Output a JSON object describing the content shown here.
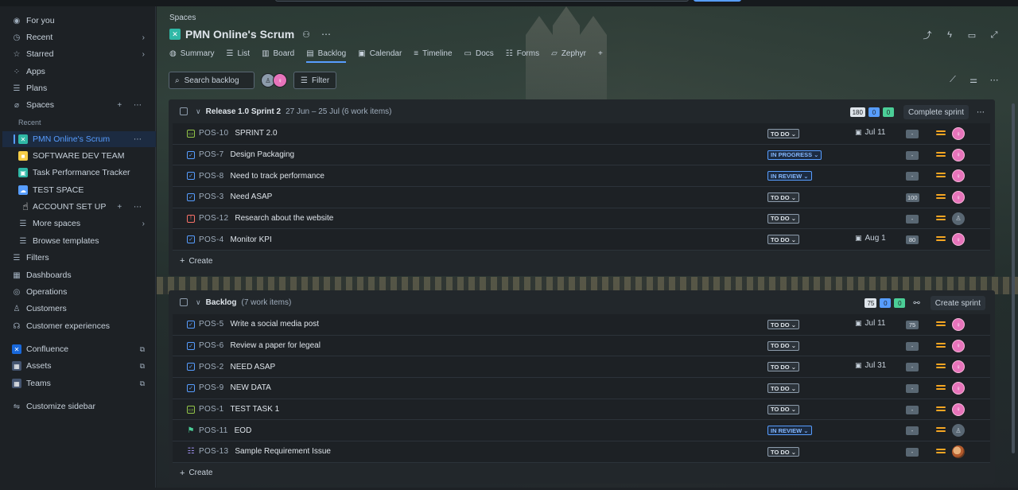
{
  "sidebar": {
    "items": [
      {
        "label": "For you",
        "icon": "user-circle-icon"
      },
      {
        "label": "Recent",
        "icon": "clock-icon"
      },
      {
        "label": "Starred",
        "icon": "star-icon"
      },
      {
        "label": "Apps",
        "icon": "apps-icon"
      },
      {
        "label": "Plans",
        "icon": "plans-icon"
      },
      {
        "label": "Spaces",
        "icon": "spaces-icon"
      }
    ],
    "recent_label": "Recent",
    "spaces": [
      {
        "label": "PMN Online's Scrum",
        "color": "#2fb8a6"
      },
      {
        "label": "SOFTWARE DEV TEAM",
        "color": "#f5cd47"
      },
      {
        "label": "Task Performance Tracker",
        "color": "#2fb8a6"
      },
      {
        "label": "TEST SPACE",
        "color": "#579dff"
      },
      {
        "label": "ACCOUNT SET UP",
        "color": "#9f8fef"
      }
    ],
    "more_spaces": "More spaces",
    "browse_templates": "Browse templates",
    "bottom_items": [
      {
        "label": "Filters"
      },
      {
        "label": "Dashboards"
      },
      {
        "label": "Operations"
      },
      {
        "label": "Customers"
      },
      {
        "label": "Customer experiences"
      }
    ],
    "apps": [
      {
        "label": "Confluence",
        "color": "#1868db"
      },
      {
        "label": "Assets",
        "color": "#44546f"
      },
      {
        "label": "Teams",
        "color": "#44546f"
      }
    ],
    "customize": "Customize sidebar"
  },
  "header": {
    "breadcrumb": "Spaces",
    "title": "PMN Online's Scrum",
    "tabs": [
      "Summary",
      "List",
      "Board",
      "Backlog",
      "Calendar",
      "Timeline",
      "Docs",
      "Forms",
      "Zephyr"
    ],
    "active_tab": "Backlog"
  },
  "toolbar": {
    "search_placeholder": "Search backlog",
    "filter_label": "Filter"
  },
  "sprint": {
    "title": "Release 1.0 Sprint 2",
    "meta": "27 Jun – 25 Jul (6 work items)",
    "counts": [
      "180",
      "0",
      "0"
    ],
    "action": "Complete sprint",
    "rows": [
      {
        "type": "story",
        "key": "POS-10",
        "summary": "SPRINT 2.0",
        "status": "TO DO",
        "due": "Jul 11",
        "est": "-",
        "assignee": "pink"
      },
      {
        "type": "task",
        "key": "POS-7",
        "summary": "Design Packaging",
        "status": "IN PROGRESS",
        "due": "",
        "est": "-",
        "assignee": "pink"
      },
      {
        "type": "task",
        "key": "POS-8",
        "summary": "Need to track performance",
        "status": "IN REVIEW",
        "due": "",
        "est": "-",
        "assignee": "pink"
      },
      {
        "type": "task",
        "key": "POS-3",
        "summary": "Need ASAP",
        "status": "TO DO",
        "due": "",
        "est": "100",
        "assignee": "pink"
      },
      {
        "type": "bug",
        "key": "POS-12",
        "summary": "Research about the website",
        "status": "TO DO",
        "due": "",
        "est": "-",
        "assignee": "grey"
      },
      {
        "type": "task",
        "key": "POS-4",
        "summary": "Monitor KPI",
        "status": "TO DO",
        "due": "Aug 1",
        "est": "80",
        "assignee": "pink"
      }
    ],
    "create": "Create"
  },
  "backlog": {
    "title": "Backlog",
    "meta": "(7 work items)",
    "counts": [
      "75",
      "0",
      "0"
    ],
    "action": "Create sprint",
    "rows": [
      {
        "type": "task",
        "key": "POS-5",
        "summary": "Write a social media post",
        "status": "TO DO",
        "due": "Jul 11",
        "est": "75",
        "assignee": "pink"
      },
      {
        "type": "task",
        "key": "POS-6",
        "summary": "Review a paper for legeal",
        "status": "TO DO",
        "due": "",
        "est": "-",
        "assignee": "pink"
      },
      {
        "type": "task",
        "key": "POS-2",
        "summary": "NEED ASAP",
        "status": "TO DO",
        "due": "Jul 31",
        "est": "-",
        "assignee": "pink"
      },
      {
        "type": "task",
        "key": "POS-9",
        "summary": "NEW DATA",
        "status": "TO DO",
        "due": "",
        "est": "-",
        "assignee": "pink"
      },
      {
        "type": "story",
        "key": "POS-1",
        "summary": "TEST TASK 1",
        "status": "TO DO",
        "due": "",
        "est": "-",
        "assignee": "pink"
      },
      {
        "type": "mark",
        "key": "POS-11",
        "summary": "EOD",
        "status": "IN REVIEW",
        "due": "",
        "est": "-",
        "assignee": "grey"
      },
      {
        "type": "req",
        "key": "POS-13",
        "summary": "Sample Requirement Issue",
        "status": "TO DO",
        "due": "",
        "est": "-",
        "assignee": "photo"
      }
    ],
    "create": "Create"
  }
}
